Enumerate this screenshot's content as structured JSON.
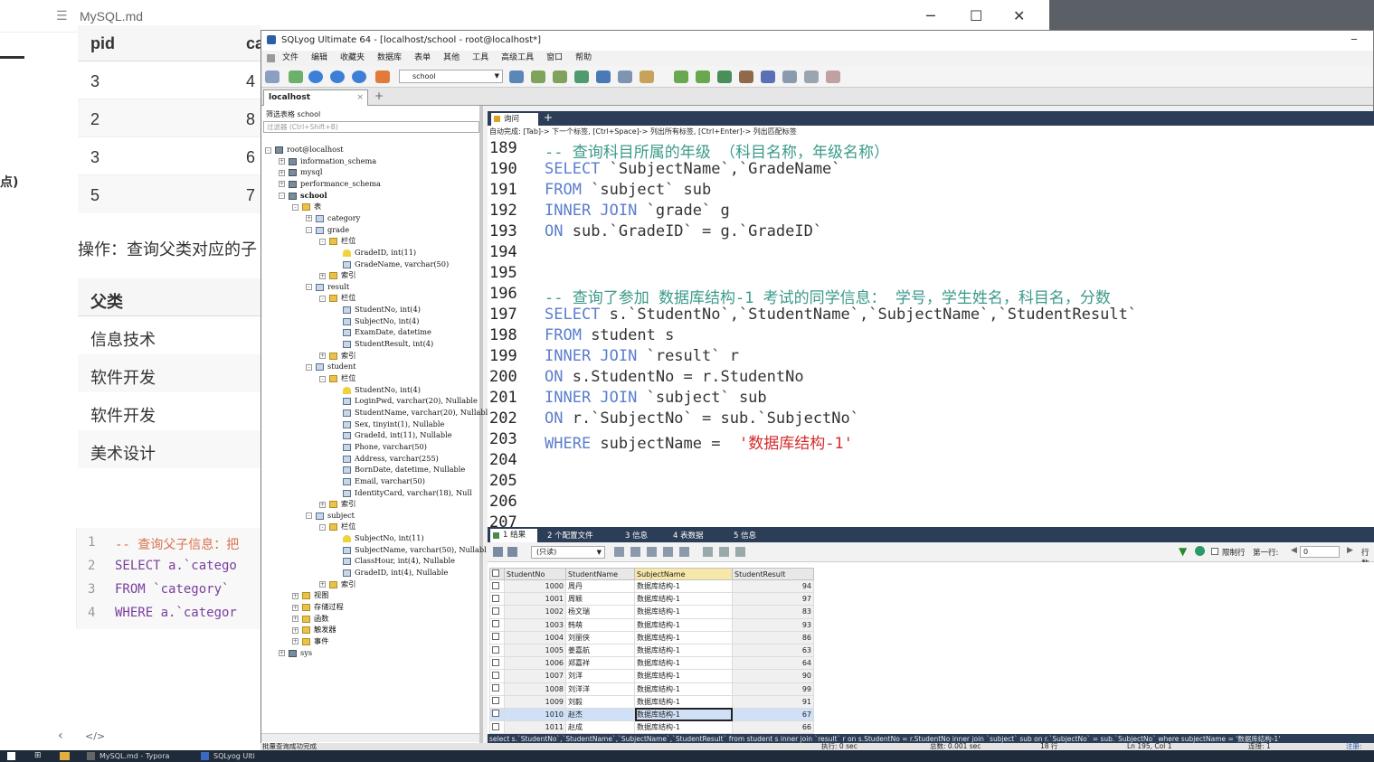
{
  "typora": {
    "title": "MySQL.md",
    "table_header": [
      "pid",
      "ca"
    ],
    "table_rows": [
      [
        "3",
        "4"
      ],
      [
        "2",
        "8"
      ],
      [
        "3",
        "6"
      ],
      [
        "5",
        "7"
      ]
    ],
    "side_note": "点)",
    "operation": "操作：查询父类对应的子",
    "table2_header": "父类",
    "table2_rows": [
      "信息技术",
      "软件开发",
      "软件开发",
      "美术设计"
    ],
    "code_lines": [
      {
        "n": "1",
        "t": "-- 查询父子信息：把"
      },
      {
        "n": "2",
        "t": "SELECT a.`catego"
      },
      {
        "n": "3",
        "t": "FROM `category`"
      },
      {
        "n": "4",
        "t": "WHERE a.`categor"
      }
    ],
    "footer_icons": [
      "‹",
      "</>"
    ]
  },
  "sqlyog": {
    "title": "SQLyog Ultimate 64 - [localhost/school - root@localhost*]",
    "menu": [
      "文件",
      "编辑",
      "收藏夹",
      "数据库",
      "表单",
      "其他",
      "工具",
      "高级工具",
      "窗口",
      "帮助"
    ],
    "db_select": "school",
    "conn_tab": "localhost",
    "filter_label": "筛选表格 school",
    "filter_placeholder": "过滤器 (Ctrl+Shift+B)",
    "query_tab": "询问",
    "hint": "自动完成: [Tab]-> 下一个标签, [Ctrl+Space]-> 列出所有标签, [Ctrl+Enter]-> 列出匹配标签",
    "tree": [
      {
        "d": 0,
        "t": "root@localhost",
        "i": "db",
        "e": "-"
      },
      {
        "d": 1,
        "t": "information_schema",
        "i": "db",
        "e": "+"
      },
      {
        "d": 1,
        "t": "mysql",
        "i": "db",
        "e": "+"
      },
      {
        "d": 1,
        "t": "performance_schema",
        "i": "db",
        "e": "+"
      },
      {
        "d": 1,
        "t": "school",
        "i": "db",
        "e": "-",
        "b": true
      },
      {
        "d": 2,
        "t": "表",
        "i": "fold",
        "e": "-"
      },
      {
        "d": 3,
        "t": "category",
        "i": "tbl",
        "e": "+"
      },
      {
        "d": 3,
        "t": "grade",
        "i": "tbl",
        "e": "-"
      },
      {
        "d": 4,
        "t": "栏位",
        "i": "fold",
        "e": "-"
      },
      {
        "d": 5,
        "t": "GradeID, int(11)",
        "i": "key",
        "e": ""
      },
      {
        "d": 5,
        "t": "GradeName, varchar(50)",
        "i": "tbl",
        "e": ""
      },
      {
        "d": 4,
        "t": "索引",
        "i": "fold",
        "e": "+"
      },
      {
        "d": 3,
        "t": "result",
        "i": "tbl",
        "e": "-"
      },
      {
        "d": 4,
        "t": "栏位",
        "i": "fold",
        "e": "-"
      },
      {
        "d": 5,
        "t": "StudentNo, int(4)",
        "i": "tbl",
        "e": ""
      },
      {
        "d": 5,
        "t": "SubjectNo, int(4)",
        "i": "tbl",
        "e": ""
      },
      {
        "d": 5,
        "t": "ExamDate, datetime",
        "i": "tbl",
        "e": ""
      },
      {
        "d": 5,
        "t": "StudentResult, int(4)",
        "i": "tbl",
        "e": ""
      },
      {
        "d": 4,
        "t": "索引",
        "i": "fold",
        "e": "+"
      },
      {
        "d": 3,
        "t": "student",
        "i": "tbl",
        "e": "-"
      },
      {
        "d": 4,
        "t": "栏位",
        "i": "fold",
        "e": "-"
      },
      {
        "d": 5,
        "t": "StudentNo, int(4)",
        "i": "key",
        "e": ""
      },
      {
        "d": 5,
        "t": "LoginPwd, varchar(20), Nullable",
        "i": "tbl",
        "e": ""
      },
      {
        "d": 5,
        "t": "StudentName, varchar(20), Nullabl",
        "i": "tbl",
        "e": ""
      },
      {
        "d": 5,
        "t": "Sex, tinyint(1), Nullable",
        "i": "tbl",
        "e": ""
      },
      {
        "d": 5,
        "t": "GradeId, int(11), Nullable",
        "i": "tbl",
        "e": ""
      },
      {
        "d": 5,
        "t": "Phone, varchar(50)",
        "i": "tbl",
        "e": ""
      },
      {
        "d": 5,
        "t": "Address, varchar(255)",
        "i": "tbl",
        "e": ""
      },
      {
        "d": 5,
        "t": "BornDate, datetime, Nullable",
        "i": "tbl",
        "e": ""
      },
      {
        "d": 5,
        "t": "Email, varchar(50)",
        "i": "tbl",
        "e": ""
      },
      {
        "d": 5,
        "t": "IdentityCard, varchar(18), Null",
        "i": "tbl",
        "e": ""
      },
      {
        "d": 4,
        "t": "索引",
        "i": "fold",
        "e": "+"
      },
      {
        "d": 3,
        "t": "subject",
        "i": "tbl",
        "e": "-"
      },
      {
        "d": 4,
        "t": "栏位",
        "i": "fold",
        "e": "-"
      },
      {
        "d": 5,
        "t": "SubjectNo, int(11)",
        "i": "key",
        "e": ""
      },
      {
        "d": 5,
        "t": "SubjectName, varchar(50), Nullabl",
        "i": "tbl",
        "e": ""
      },
      {
        "d": 5,
        "t": "ClassHour, int(4), Nullable",
        "i": "tbl",
        "e": ""
      },
      {
        "d": 5,
        "t": "GradeID, int(4), Nullable",
        "i": "tbl",
        "e": ""
      },
      {
        "d": 4,
        "t": "索引",
        "i": "fold",
        "e": "+"
      },
      {
        "d": 2,
        "t": "视图",
        "i": "fold",
        "e": "+"
      },
      {
        "d": 2,
        "t": "存储过程",
        "i": "fold",
        "e": "+"
      },
      {
        "d": 2,
        "t": "函数",
        "i": "fold",
        "e": "+"
      },
      {
        "d": 2,
        "t": "触发器",
        "i": "fold",
        "e": "+"
      },
      {
        "d": 2,
        "t": "事件",
        "i": "fold",
        "e": "+"
      },
      {
        "d": 1,
        "t": "sys",
        "i": "db",
        "e": "+"
      }
    ],
    "code": [
      {
        "n": "189",
        "parts": [
          [
            "cm",
            "-- 查询科目所属的年级 （科目名称，年级名称）"
          ]
        ]
      },
      {
        "n": "190",
        "parts": [
          [
            "kw",
            "SELECT"
          ],
          [
            "",
            "`SubjectName`,`GradeName`"
          ]
        ]
      },
      {
        "n": "191",
        "parts": [
          [
            "kw",
            "FROM"
          ],
          [
            "",
            "`subject` sub"
          ]
        ]
      },
      {
        "n": "192",
        "parts": [
          [
            "kw",
            "INNER JOIN"
          ],
          [
            "",
            "`grade` g"
          ]
        ]
      },
      {
        "n": "193",
        "parts": [
          [
            "kw",
            "ON"
          ],
          [
            "",
            "sub.`GradeID` = g.`GradeID`"
          ]
        ]
      },
      {
        "n": "194",
        "parts": []
      },
      {
        "n": "195",
        "parts": []
      },
      {
        "n": "196",
        "parts": [
          [
            "cm",
            "-- 查询了参加 数据库结构-1 考试的同学信息： 学号，学生姓名，科目名，分数"
          ]
        ]
      },
      {
        "n": "197",
        "parts": [
          [
            "kw",
            "SELECT"
          ],
          [
            "",
            "s.`StudentNo`,`StudentName`,`SubjectName`,`StudentResult`"
          ]
        ]
      },
      {
        "n": "198",
        "parts": [
          [
            "kw",
            "FROM"
          ],
          [
            "",
            "student s"
          ]
        ]
      },
      {
        "n": "199",
        "parts": [
          [
            "kw",
            "INNER JOIN"
          ],
          [
            "",
            "`result` r"
          ]
        ]
      },
      {
        "n": "200",
        "parts": [
          [
            "kw",
            "ON"
          ],
          [
            "",
            "s.StudentNo = r.StudentNo"
          ]
        ]
      },
      {
        "n": "201",
        "parts": [
          [
            "kw",
            "INNER JOIN"
          ],
          [
            "",
            "`subject` sub"
          ]
        ]
      },
      {
        "n": "202",
        "parts": [
          [
            "kw",
            "ON"
          ],
          [
            "",
            "r.`SubjectNo` = sub.`SubjectNo`"
          ]
        ]
      },
      {
        "n": "203",
        "parts": [
          [
            "kw",
            "WHERE"
          ],
          [
            "",
            "subjectName = "
          ],
          [
            "str",
            "'数据库结构-1'"
          ]
        ]
      },
      {
        "n": "204",
        "parts": []
      },
      {
        "n": "205",
        "parts": []
      },
      {
        "n": "206",
        "parts": []
      },
      {
        "n": "207",
        "parts": []
      }
    ],
    "result_tabs": [
      "1 结果",
      "2 个配置文件",
      "3 信息",
      "4 表数据",
      "5 信息"
    ],
    "readonly_label": "(只读)",
    "limit_label": "限制行",
    "first_row_label": "第一行:",
    "first_row_value": "0",
    "rows_label": "行数",
    "columns": [
      "StudentNo",
      "StudentName",
      "SubjectName",
      "StudentResult"
    ],
    "rows": [
      [
        "1000",
        "周丹",
        "数据库结构-1",
        "94"
      ],
      [
        "1001",
        "周颖",
        "数据库结构-1",
        "97"
      ],
      [
        "1002",
        "杨文瑞",
        "数据库结构-1",
        "83"
      ],
      [
        "1003",
        "韩萌",
        "数据库结构-1",
        "93"
      ],
      [
        "1004",
        "刘丽侠",
        "数据库结构-1",
        "86"
      ],
      [
        "1005",
        "姜嘉航",
        "数据库结构-1",
        "63"
      ],
      [
        "1006",
        "郑嘉祥",
        "数据库结构-1",
        "64"
      ],
      [
        "1007",
        "刘洋",
        "数据库结构-1",
        "90"
      ],
      [
        "1008",
        "刘洋洋",
        "数据库结构-1",
        "99"
      ],
      [
        "1009",
        "刘毅",
        "数据库结构-1",
        "91"
      ],
      [
        "1010",
        "赵杰",
        "数据库结构-1",
        "67"
      ],
      [
        "1011",
        "赵成",
        "数据库结构-1",
        "66"
      ]
    ],
    "selected_row": 10,
    "sql_preview": "select s.`StudentNo`,`StudentName`,`SubjectName`,`StudentResult` from student s inner join `result` r on s.StudentNo = r.StudentNo inner join `subject` sub on r.`SubjectNo` = sub.`SubjectNo` where subjectName = '数据库结构-1'",
    "status": {
      "msg": "批量查询成功完成",
      "exec": "执行: 0 sec",
      "total": "总数: 0.001 sec",
      "rows": "18 行",
      "pos": "Ln 195, Col 1",
      "conn": "连接: 1",
      "reg": "注册:"
    }
  },
  "taskbar": {
    "items": [
      "MySQL.md - Typora",
      "SQLyog Ulti"
    ]
  },
  "colors": {
    "keyword": "#5b7ecc",
    "comment": "#3a9a8a",
    "string": "#d62b2b",
    "tabbar": "#2c3d57"
  }
}
